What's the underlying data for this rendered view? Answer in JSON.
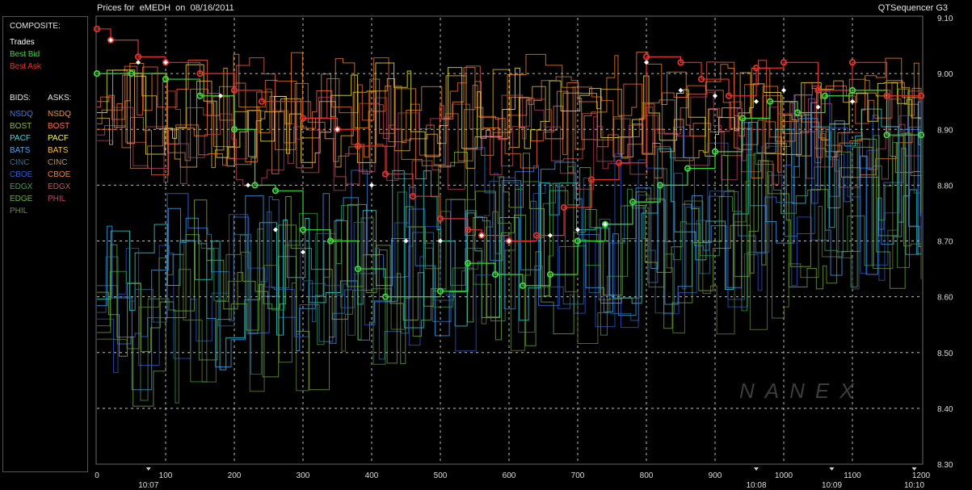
{
  "header": {
    "title": "Prices for  eMEDH  on  08/16/2011",
    "product": "QTSequencer G3"
  },
  "legend": {
    "composite_label": "COMPOSITE:",
    "composite": [
      {
        "label": "Trades",
        "color": "#ffffff"
      },
      {
        "label": "Best Bid",
        "color": "#3ad83a"
      },
      {
        "label": "Best Ask",
        "color": "#e8302a"
      }
    ],
    "bids_label": "BIDS:",
    "asks_label": "ASKS:",
    "bids": [
      {
        "label": "NSDQ",
        "color": "#3c78e8"
      },
      {
        "label": "BOST",
        "color": "#8ab83a"
      },
      {
        "label": "PACF",
        "color": "#2ee0e8"
      },
      {
        "label": "BATS",
        "color": "#41a8ff"
      },
      {
        "label": "CINC",
        "color": "#2f6f9a"
      },
      {
        "label": "CBOE",
        "color": "#2b5bd0"
      },
      {
        "label": "EDGX",
        "color": "#3fa04a"
      },
      {
        "label": "EDGE",
        "color": "#6fae3a"
      },
      {
        "label": "PHIL",
        "color": "#6a8a3a"
      }
    ],
    "asks": [
      {
        "label": "NSDQ",
        "color": "#ff8a2a"
      },
      {
        "label": "BOST",
        "color": "#ff6a4a"
      },
      {
        "label": "PACF",
        "color": "#ffff40"
      },
      {
        "label": "BATS",
        "color": "#ffc040"
      },
      {
        "label": "CINC",
        "color": "#c89050"
      },
      {
        "label": "CBOE",
        "color": "#ff7a2a"
      },
      {
        "label": "EDGX",
        "color": "#d05050"
      },
      {
        "label": "PHIL",
        "color": "#c04070"
      }
    ]
  },
  "watermark": "NANEX",
  "chart_data": {
    "type": "line",
    "title": "Prices for  eMEDH  on  08/16/2011",
    "ylim": [
      8.3,
      9.1
    ],
    "xlim": [
      0,
      1200
    ],
    "y_ticks": [
      "9.10",
      "9.00",
      "8.90",
      "8.80",
      "8.70",
      "8.60",
      "8.50",
      "8.40",
      "8.30"
    ],
    "x_ticks": [
      "0",
      "100",
      "200",
      "300",
      "400",
      "500",
      "600",
      "700",
      "800",
      "900",
      "1000",
      "1100",
      "1200"
    ],
    "time_labels": [
      {
        "x": 75,
        "label": "10:07"
      },
      {
        "x": 960,
        "label": "10:08"
      },
      {
        "x": 1070,
        "label": "10:09"
      },
      {
        "x": 1190,
        "label": "10:10"
      }
    ],
    "grid": true,
    "series": [
      {
        "name": "Best Ask",
        "color": "#e8302a",
        "points": [
          [
            0,
            9.08
          ],
          [
            20,
            9.06
          ],
          [
            60,
            9.03
          ],
          [
            100,
            9.02
          ],
          [
            150,
            9.0
          ],
          [
            200,
            8.97
          ],
          [
            240,
            8.95
          ],
          [
            300,
            8.92
          ],
          [
            350,
            8.9
          ],
          [
            380,
            8.87
          ],
          [
            420,
            8.82
          ],
          [
            460,
            8.78
          ],
          [
            500,
            8.74
          ],
          [
            540,
            8.72
          ],
          [
            560,
            8.71
          ],
          [
            600,
            8.7
          ],
          [
            640,
            8.71
          ],
          [
            680,
            8.76
          ],
          [
            720,
            8.81
          ],
          [
            760,
            8.84
          ],
          [
            800,
            9.03
          ],
          [
            850,
            9.02
          ],
          [
            880,
            8.99
          ],
          [
            920,
            8.96
          ],
          [
            960,
            9.01
          ],
          [
            1000,
            9.02
          ],
          [
            1050,
            8.97
          ],
          [
            1100,
            9.02
          ],
          [
            1150,
            8.96
          ],
          [
            1200,
            8.96
          ]
        ]
      },
      {
        "name": "Best Bid",
        "color": "#3ad83a",
        "points": [
          [
            0,
            9.0
          ],
          [
            50,
            9.0
          ],
          [
            100,
            8.99
          ],
          [
            150,
            8.96
          ],
          [
            200,
            8.9
          ],
          [
            230,
            8.8
          ],
          [
            260,
            8.79
          ],
          [
            300,
            8.72
          ],
          [
            340,
            8.7
          ],
          [
            380,
            8.65
          ],
          [
            420,
            8.6
          ],
          [
            500,
            8.61
          ],
          [
            540,
            8.66
          ],
          [
            580,
            8.64
          ],
          [
            620,
            8.62
          ],
          [
            660,
            8.64
          ],
          [
            700,
            8.7
          ],
          [
            740,
            8.73
          ],
          [
            780,
            8.77
          ],
          [
            820,
            8.8
          ],
          [
            860,
            8.83
          ],
          [
            900,
            8.86
          ],
          [
            940,
            8.92
          ],
          [
            980,
            8.95
          ],
          [
            1020,
            8.93
          ],
          [
            1060,
            8.96
          ],
          [
            1100,
            8.97
          ],
          [
            1150,
            8.89
          ],
          [
            1200,
            8.89
          ]
        ]
      },
      {
        "name": "Trades",
        "color": "#ffffff",
        "points": [
          [
            20,
            9.06
          ],
          [
            60,
            9.02
          ],
          [
            100,
            9.02
          ],
          [
            180,
            8.96
          ],
          [
            220,
            8.8
          ],
          [
            260,
            8.72
          ],
          [
            300,
            8.68
          ],
          [
            350,
            8.9
          ],
          [
            400,
            8.8
          ],
          [
            450,
            8.7
          ],
          [
            500,
            8.7
          ],
          [
            560,
            8.71
          ],
          [
            600,
            8.7
          ],
          [
            660,
            8.71
          ],
          [
            700,
            8.72
          ],
          [
            740,
            8.73
          ],
          [
            800,
            9.02
          ],
          [
            850,
            8.97
          ],
          [
            900,
            8.96
          ],
          [
            960,
            8.95
          ],
          [
            1000,
            8.97
          ],
          [
            1050,
            8.94
          ],
          [
            1100,
            8.95
          ]
        ]
      }
    ]
  }
}
